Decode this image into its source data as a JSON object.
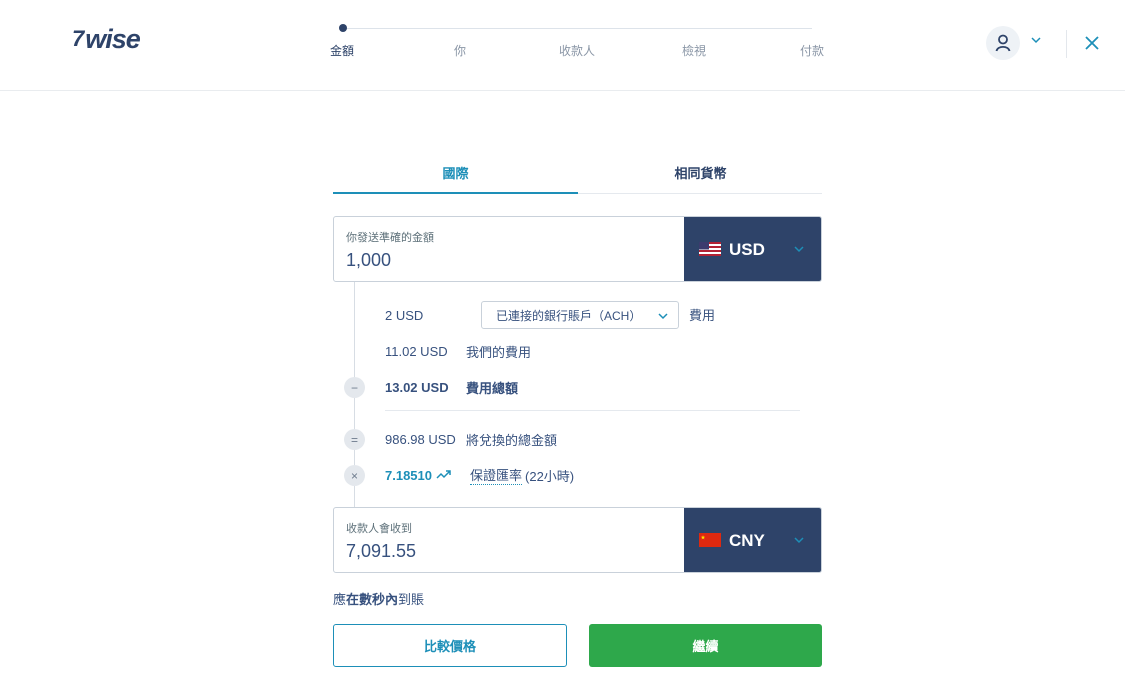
{
  "header": {
    "logo_flag": "7",
    "logo_text": "wise",
    "steps": [
      "金額",
      "你",
      "收款人",
      "檢視",
      "付款"
    ],
    "active_step": 0
  },
  "tabs": {
    "international": "國際",
    "same_currency": "相同貨幣"
  },
  "send": {
    "label": "你發送準確的金額",
    "value": "1,000",
    "currency": "USD"
  },
  "breakdown": {
    "method_fee_amount": "2 USD",
    "method_select": "已連接的銀行賬戶（ACH）",
    "method_fee_label": "費用",
    "our_fee_amount": "11.02 USD",
    "our_fee_label": "我們的費用",
    "total_fee_amount": "13.02 USD",
    "total_fee_label": "費用總額",
    "convert_amount": "986.98 USD",
    "convert_label": "將兌換的總金額",
    "rate": "7.18510",
    "rate_label": "保證匯率",
    "rate_duration": "(22小時)",
    "minus_symbol": "−",
    "equals_symbol": "=",
    "times_symbol": "×"
  },
  "receive": {
    "label": "收款人會收到",
    "value": "7,091.55",
    "currency": "CNY"
  },
  "arrival": {
    "prefix": "應",
    "bold": "在數秒內",
    "suffix": "到賬"
  },
  "buttons": {
    "compare": "比較價格",
    "continue": "繼續"
  },
  "colors": {
    "navy": "#2e4369",
    "teal": "#1d8fb8",
    "green": "#2ea84b"
  },
  "icons": {
    "profile": "user-icon",
    "close": "close-icon",
    "trend": "trend-up-icon"
  }
}
